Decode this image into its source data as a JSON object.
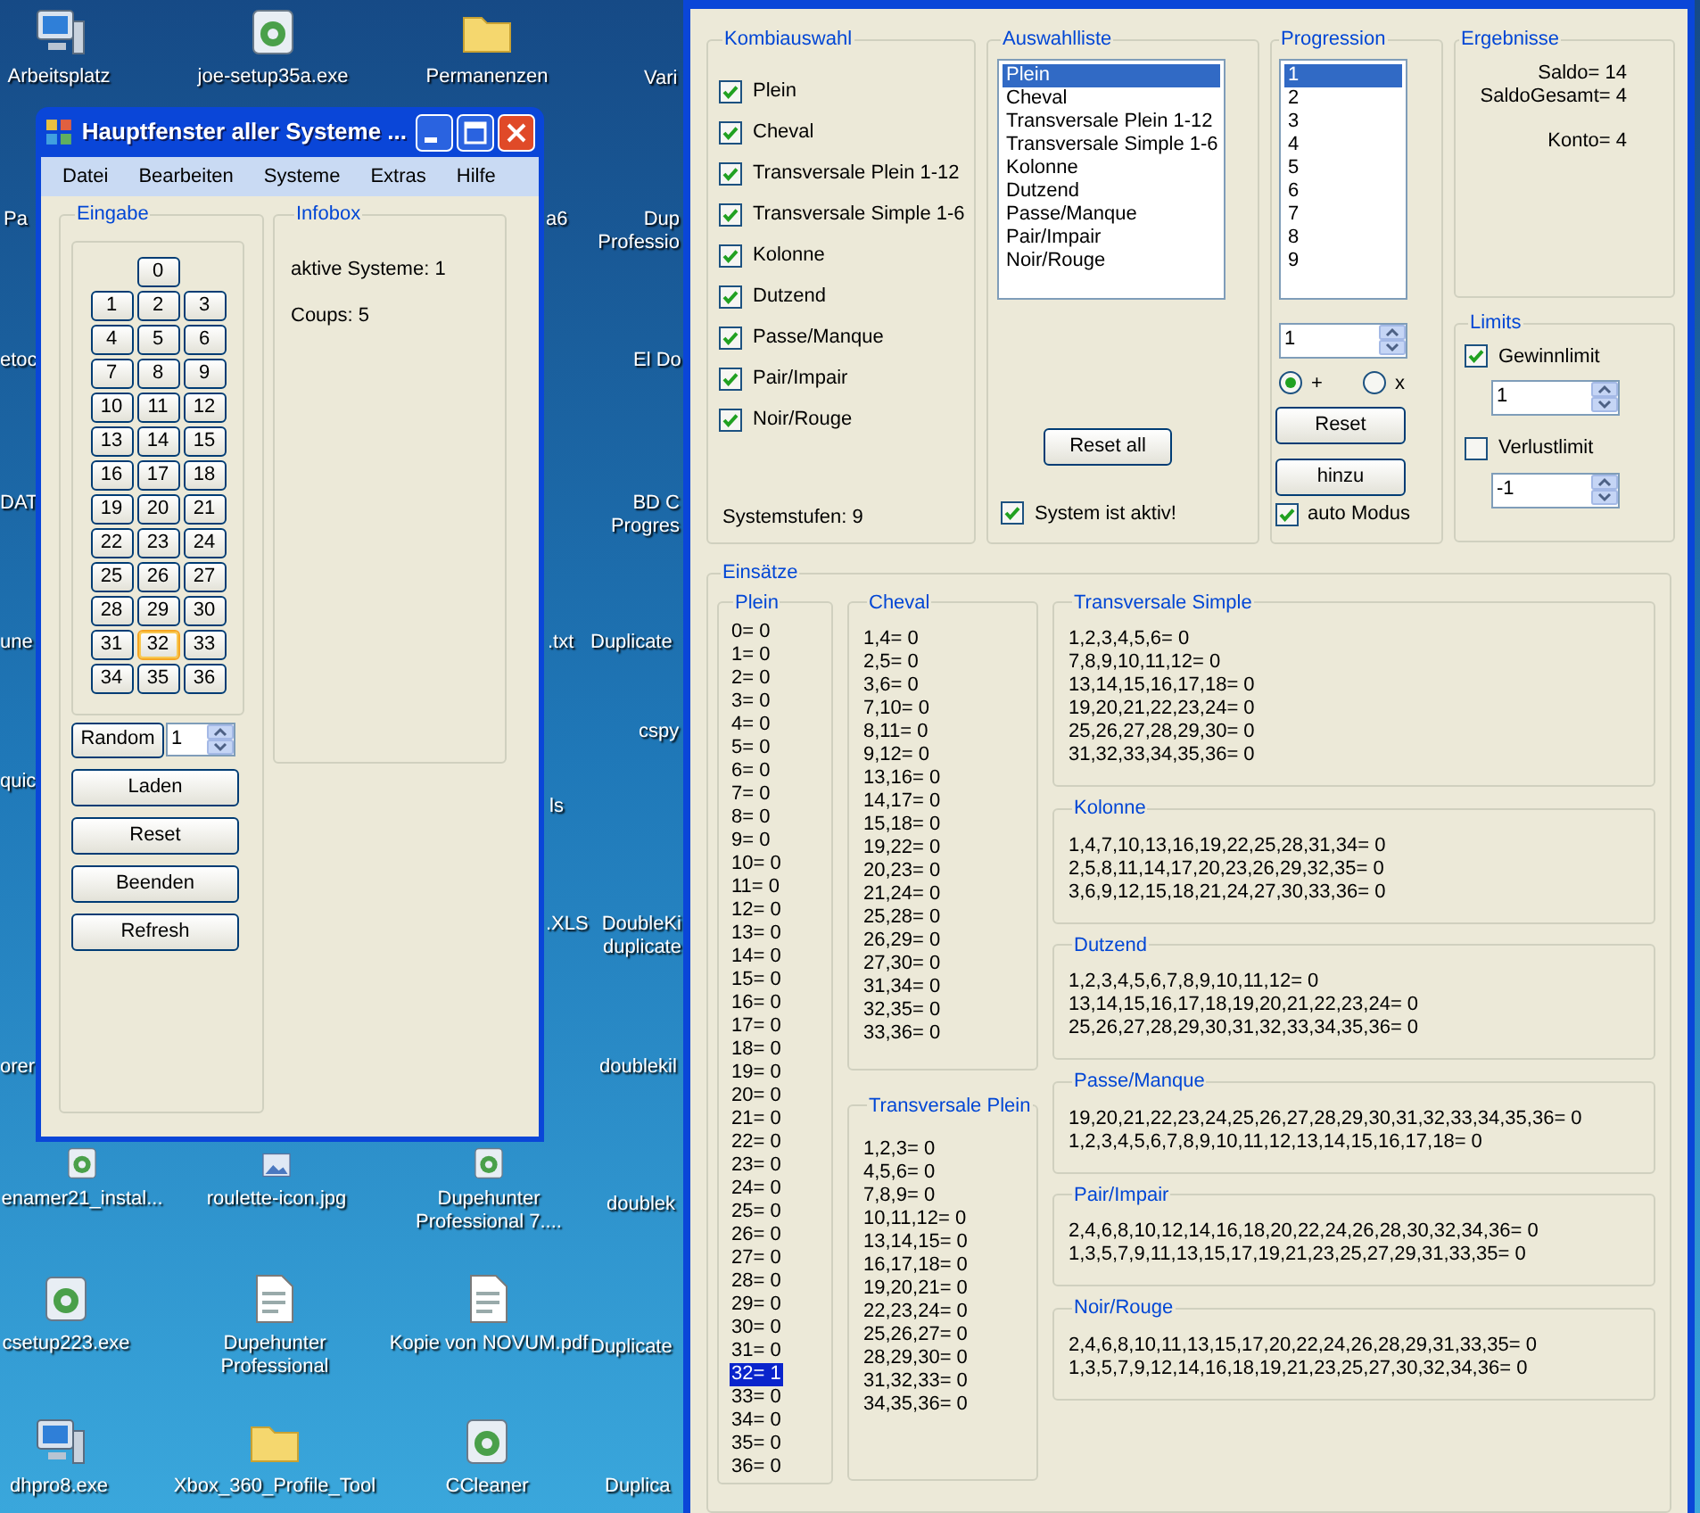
{
  "desktop": {
    "icons": [
      {
        "label": "Arbeitsplatz",
        "kind": "computer"
      },
      {
        "label": "joe-setup35a.exe",
        "kind": "program"
      },
      {
        "label": "Permanenzen",
        "kind": "folder"
      },
      {
        "label": "Vari",
        "kind": "label"
      },
      {
        "label": "Pa",
        "kind": "label"
      },
      {
        "label": "a6",
        "kind": "label"
      },
      {
        "label": "Dup Professio",
        "kind": "label"
      },
      {
        "label": "etoc",
        "kind": "label"
      },
      {
        "label": "El Do",
        "kind": "label"
      },
      {
        "label": "DAT",
        "kind": "label"
      },
      {
        "label": "BD C Progres",
        "kind": "label"
      },
      {
        "label": "une",
        "kind": "label"
      },
      {
        "label": ".txt",
        "kind": "label"
      },
      {
        "label": "Duplicate",
        "kind": "label"
      },
      {
        "label": "cspy",
        "kind": "label"
      },
      {
        "label": "quic",
        "kind": "label"
      },
      {
        "label": "ls",
        "kind": "label"
      },
      {
        "label": ".XLS",
        "kind": "label"
      },
      {
        "label": "DoubleKi duplicate",
        "kind": "label"
      },
      {
        "label": "orer",
        "kind": "label"
      },
      {
        "label": "doublekil",
        "kind": "label"
      },
      {
        "label": "enamer21_instal...",
        "kind": "program"
      },
      {
        "label": "roulette-icon.jpg",
        "kind": "image"
      },
      {
        "label": "Dupehunter Professional 7....",
        "kind": "program"
      },
      {
        "label": "doublek",
        "kind": "label"
      },
      {
        "label": "csetup223.exe",
        "kind": "program"
      },
      {
        "label": "Dupehunter Professional",
        "kind": "document"
      },
      {
        "label": "Kopie von NOVUM.pdf",
        "kind": "document"
      },
      {
        "label": "Duplicate",
        "kind": "label"
      },
      {
        "label": "dhpro8.exe",
        "kind": "computer"
      },
      {
        "label": "Xbox_360_Profile_Tool",
        "kind": "folder"
      },
      {
        "label": "CCleaner",
        "kind": "program"
      },
      {
        "label": "Duplica",
        "kind": "label"
      }
    ]
  },
  "main_window": {
    "title": "Hauptfenster aller Systeme ...",
    "menu": [
      "Datei",
      "Bearbeiten",
      "Systeme",
      "Extras",
      "Hilfe"
    ],
    "eingabe": {
      "title": "Eingabe",
      "numbers": [
        {
          "label": "0",
          "selected": false
        },
        {
          "label": "1",
          "selected": false
        },
        {
          "label": "2",
          "selected": false
        },
        {
          "label": "3",
          "selected": false
        },
        {
          "label": "4",
          "selected": false
        },
        {
          "label": "5",
          "selected": false
        },
        {
          "label": "6",
          "selected": false
        },
        {
          "label": "7",
          "selected": false
        },
        {
          "label": "8",
          "selected": false
        },
        {
          "label": "9",
          "selected": false
        },
        {
          "label": "10",
          "selected": false
        },
        {
          "label": "11",
          "selected": false
        },
        {
          "label": "12",
          "selected": false
        },
        {
          "label": "13",
          "selected": false
        },
        {
          "label": "14",
          "selected": false
        },
        {
          "label": "15",
          "selected": false
        },
        {
          "label": "16",
          "selected": false
        },
        {
          "label": "17",
          "selected": false
        },
        {
          "label": "18",
          "selected": false
        },
        {
          "label": "19",
          "selected": false
        },
        {
          "label": "20",
          "selected": false
        },
        {
          "label": "21",
          "selected": false
        },
        {
          "label": "22",
          "selected": false
        },
        {
          "label": "23",
          "selected": false
        },
        {
          "label": "24",
          "selected": false
        },
        {
          "label": "25",
          "selected": false
        },
        {
          "label": "26",
          "selected": false
        },
        {
          "label": "27",
          "selected": false
        },
        {
          "label": "28",
          "selected": false
        },
        {
          "label": "29",
          "selected": false
        },
        {
          "label": "30",
          "selected": false
        },
        {
          "label": "31",
          "selected": false
        },
        {
          "label": "32",
          "selected": true
        },
        {
          "label": "33",
          "selected": false
        },
        {
          "label": "34",
          "selected": false
        },
        {
          "label": "35",
          "selected": false
        },
        {
          "label": "36",
          "selected": false
        }
      ],
      "random_button": "Random",
      "random_value": "1",
      "buttons": [
        "Laden",
        "Reset",
        "Beenden",
        "Refresh"
      ]
    },
    "infobox": {
      "title": "Infobox",
      "lines": [
        "aktive Systeme: 1",
        "Coups: 5"
      ]
    }
  },
  "system_window": {
    "kombiauswahl": {
      "title": "Kombiauswahl",
      "options": [
        {
          "label": "Plein",
          "checked": true
        },
        {
          "label": "Cheval",
          "checked": true
        },
        {
          "label": "Transversale Plein 1-12",
          "checked": true
        },
        {
          "label": "Transversale Simple 1-6",
          "checked": true
        },
        {
          "label": "Kolonne",
          "checked": true
        },
        {
          "label": "Dutzend",
          "checked": true
        },
        {
          "label": "Passe/Manque",
          "checked": true
        },
        {
          "label": "Pair/Impair",
          "checked": true
        },
        {
          "label": "Noir/Rouge",
          "checked": true
        }
      ],
      "status": "Systemstufen: 9"
    },
    "auswahlliste": {
      "title": "Auswahlliste",
      "items": [
        {
          "label": "Plein",
          "selected": true
        },
        {
          "label": "Cheval",
          "selected": false
        },
        {
          "label": "Transversale Plein 1-12",
          "selected": false
        },
        {
          "label": "Transversale Simple 1-6",
          "selected": false
        },
        {
          "label": "Kolonne",
          "selected": false
        },
        {
          "label": "Dutzend",
          "selected": false
        },
        {
          "label": "Passe/Manque",
          "selected": false
        },
        {
          "label": "Pair/Impair",
          "selected": false
        },
        {
          "label": "Noir/Rouge",
          "selected": false
        }
      ],
      "reset_button": "Reset all",
      "active": {
        "label": "System ist aktiv!",
        "checked": true
      }
    },
    "progression": {
      "title": "Progression",
      "items": [
        {
          "label": "1",
          "selected": true
        },
        {
          "label": "2",
          "selected": false
        },
        {
          "label": "3",
          "selected": false
        },
        {
          "label": "4",
          "selected": false
        },
        {
          "label": "5",
          "selected": false
        },
        {
          "label": "6",
          "selected": false
        },
        {
          "label": "7",
          "selected": false
        },
        {
          "label": "8",
          "selected": false
        },
        {
          "label": "9",
          "selected": false
        }
      ],
      "value": "1",
      "modes": [
        {
          "label": "+",
          "selected": true
        },
        {
          "label": "x",
          "selected": false
        }
      ],
      "buttons": [
        "Reset",
        "hinzu"
      ],
      "auto": {
        "label": "auto Modus",
        "checked": true
      }
    },
    "ergebnisse": {
      "title": "Ergebnisse",
      "lines": [
        "Saldo= 14",
        "SaldoGesamt= 4",
        "Konto= 4"
      ]
    },
    "limits": {
      "title": "Limits",
      "items": [
        {
          "label": "Gewinnlimit",
          "checked": true,
          "value": "1"
        },
        {
          "label": "Verlustlimit",
          "checked": false,
          "value": "-1"
        }
      ]
    },
    "einsaetze": {
      "title": "Einsätze",
      "plein": {
        "title": "Plein",
        "items": [
          {
            "label": "0= 0",
            "selected": false
          },
          {
            "label": "1= 0",
            "selected": false
          },
          {
            "label": "2= 0",
            "selected": false
          },
          {
            "label": "3= 0",
            "selected": false
          },
          {
            "label": "4= 0",
            "selected": false
          },
          {
            "label": "5= 0",
            "selected": false
          },
          {
            "label": "6= 0",
            "selected": false
          },
          {
            "label": "7= 0",
            "selected": false
          },
          {
            "label": "8= 0",
            "selected": false
          },
          {
            "label": "9= 0",
            "selected": false
          },
          {
            "label": "10= 0",
            "selected": false
          },
          {
            "label": "11= 0",
            "selected": false
          },
          {
            "label": "12= 0",
            "selected": false
          },
          {
            "label": "13= 0",
            "selected": false
          },
          {
            "label": "14= 0",
            "selected": false
          },
          {
            "label": "15= 0",
            "selected": false
          },
          {
            "label": "16= 0",
            "selected": false
          },
          {
            "label": "17= 0",
            "selected": false
          },
          {
            "label": "18= 0",
            "selected": false
          },
          {
            "label": "19= 0",
            "selected": false
          },
          {
            "label": "20= 0",
            "selected": false
          },
          {
            "label": "21= 0",
            "selected": false
          },
          {
            "label": "22= 0",
            "selected": false
          },
          {
            "label": "23= 0",
            "selected": false
          },
          {
            "label": "24= 0",
            "selected": false
          },
          {
            "label": "25= 0",
            "selected": false
          },
          {
            "label": "26= 0",
            "selected": false
          },
          {
            "label": "27= 0",
            "selected": false
          },
          {
            "label": "28= 0",
            "selected": false
          },
          {
            "label": "29= 0",
            "selected": false
          },
          {
            "label": "30= 0",
            "selected": false
          },
          {
            "label": "31= 0",
            "selected": false
          },
          {
            "label": "32= 1",
            "selected": true
          },
          {
            "label": "33= 0",
            "selected": false
          },
          {
            "label": "34= 0",
            "selected": false
          },
          {
            "label": "35= 0",
            "selected": false
          },
          {
            "label": "36= 0",
            "selected": false
          }
        ]
      },
      "cheval": {
        "title": "Cheval",
        "lines": [
          "1,4= 0",
          "2,5= 0",
          "3,6= 0",
          "7,10= 0",
          "8,11= 0",
          "9,12= 0",
          "13,16= 0",
          "14,17= 0",
          "15,18= 0",
          "19,22= 0",
          "20,23= 0",
          "21,24= 0",
          "25,28= 0",
          "26,29= 0",
          "27,30= 0",
          "31,34= 0",
          "32,35= 0",
          "33,36= 0"
        ]
      },
      "transversale_plein": {
        "title": "Transversale Plein",
        "lines": [
          "1,2,3= 0",
          "4,5,6= 0",
          "7,8,9= 0",
          "10,11,12= 0",
          "13,14,15= 0",
          "16,17,18= 0",
          "19,20,21= 0",
          "22,23,24= 0",
          "25,26,27= 0",
          "28,29,30= 0",
          "31,32,33= 0",
          "34,35,36= 0"
        ]
      },
      "groups": [
        {
          "title": "Transversale Simple",
          "lines": [
            "1,2,3,4,5,6= 0",
            "7,8,9,10,11,12= 0",
            "13,14,15,16,17,18= 0",
            "19,20,21,22,23,24= 0",
            "25,26,27,28,29,30= 0",
            "31,32,33,34,35,36= 0"
          ]
        },
        {
          "title": "Kolonne",
          "lines": [
            "1,4,7,10,13,16,19,22,25,28,31,34= 0",
            "2,5,8,11,14,17,20,23,26,29,32,35= 0",
            "3,6,9,12,15,18,21,24,27,30,33,36= 0"
          ]
        },
        {
          "title": "Dutzend",
          "lines": [
            "1,2,3,4,5,6,7,8,9,10,11,12= 0",
            "13,14,15,16,17,18,19,20,21,22,23,24= 0",
            "25,26,27,28,29,30,31,32,33,34,35,36= 0"
          ]
        },
        {
          "title": "Passe/Manque",
          "lines": [
            "19,20,21,22,23,24,25,26,27,28,29,30,31,32,33,34,35,36= 0",
            "1,2,3,4,5,6,7,8,9,10,11,12,13,14,15,16,17,18= 0"
          ]
        },
        {
          "title": "Pair/Impair",
          "lines": [
            "2,4,6,8,10,12,14,16,18,20,22,24,26,28,30,32,34,36= 0",
            "1,3,5,7,9,11,13,15,17,19,21,23,25,27,29,31,33,35= 0"
          ]
        },
        {
          "title": "Noir/Rouge",
          "lines": [
            "2,4,6,8,10,11,13,15,17,20,22,24,26,28,29,31,33,35= 0",
            "1,3,5,7,9,12,14,16,18,19,21,23,25,27,30,32,34,36= 0"
          ]
        }
      ]
    }
  }
}
